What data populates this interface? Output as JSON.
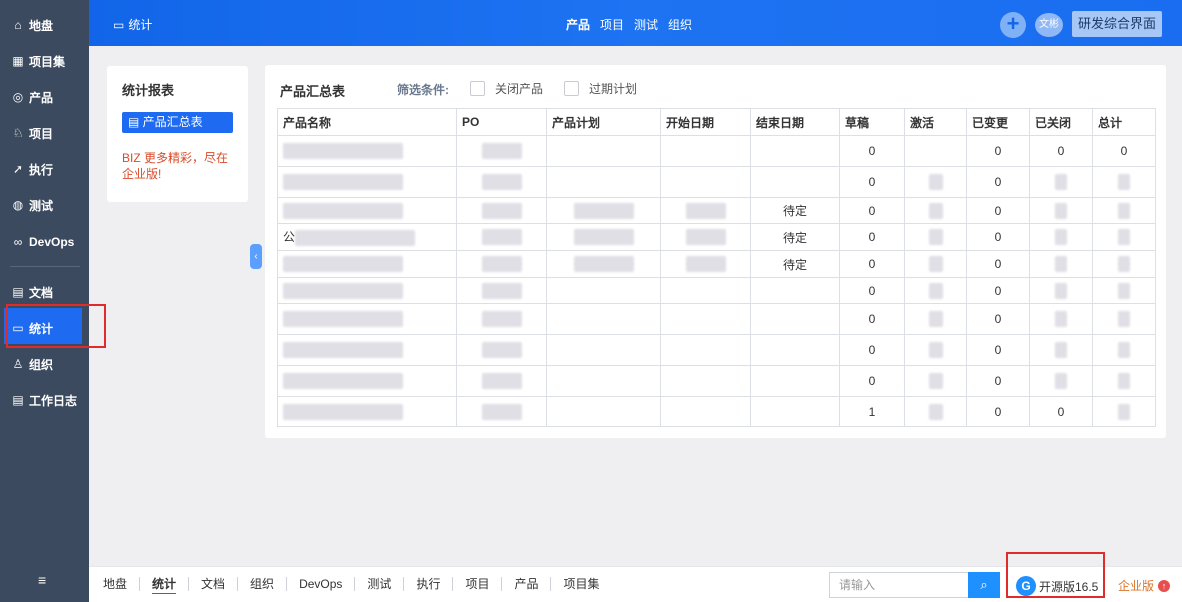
{
  "sidebar": {
    "items": [
      {
        "label": "地盘",
        "icon": "home-icon",
        "glyph": "⌂"
      },
      {
        "label": "项目集",
        "icon": "grid-icon",
        "glyph": "▦"
      },
      {
        "label": "产品",
        "icon": "product-icon",
        "glyph": "◎"
      },
      {
        "label": "项目",
        "icon": "project-icon",
        "glyph": "♘"
      },
      {
        "label": "执行",
        "icon": "run-icon",
        "glyph": "➚"
      },
      {
        "label": "测试",
        "icon": "test-icon",
        "glyph": "◍"
      },
      {
        "label": "DevOps",
        "icon": "infinity-icon",
        "glyph": "∞"
      },
      {
        "label": "文档",
        "icon": "doc-icon",
        "glyph": "▤"
      },
      {
        "label": "统计",
        "icon": "chart-icon",
        "glyph": "▭"
      },
      {
        "label": "组织",
        "icon": "people-icon",
        "glyph": "♙"
      },
      {
        "label": "工作日志",
        "icon": "log-icon",
        "glyph": "▤"
      }
    ],
    "active": "统计",
    "collapse_glyph": "≡"
  },
  "topbar": {
    "title": "统计",
    "title_icon": "chart-icon",
    "nav": [
      "产品",
      "项目",
      "测试",
      "组织"
    ],
    "nav_active": "产品",
    "add_glyph": "+",
    "avatar_text": "文彬",
    "right_button": "研发综合界面"
  },
  "left_panel": {
    "title": "统计报表",
    "link_label": "产品汇总表",
    "biz_tag": "BIZ",
    "biz_text": "更多精彩，尽在企业版!"
  },
  "collapse_glyph": "‹",
  "report": {
    "title": "产品汇总表",
    "filter_label": "筛选条件:",
    "checkbox_closed_product": "关闭产品",
    "checkbox_expired_plan": "过期计划",
    "columns": [
      "产品名称",
      "PO",
      "产品计划",
      "开始日期",
      "结束日期",
      "草稿",
      "激活",
      "已变更",
      "已关闭",
      "总计"
    ],
    "rows": [
      {
        "name": "",
        "end": "",
        "draft": "0",
        "changed": "0",
        "closed": "0",
        "total": "0"
      },
      {
        "name": "",
        "end": "",
        "draft": "0",
        "changed": "0",
        "closed": "",
        "total": ""
      },
      {
        "name": "",
        "end": "待定",
        "draft": "0",
        "changed": "0",
        "closed": "",
        "total": ""
      },
      {
        "name": "公",
        "end": "待定",
        "draft": "0",
        "changed": "0",
        "closed": "",
        "total": ""
      },
      {
        "name": "",
        "end": "待定",
        "draft": "0",
        "changed": "0",
        "closed": "",
        "total": ""
      },
      {
        "name": "",
        "end": "",
        "draft": "0",
        "changed": "0",
        "closed": "",
        "total": ""
      },
      {
        "name": "",
        "end": "",
        "draft": "0",
        "changed": "0",
        "closed": "",
        "total": ""
      },
      {
        "name": "",
        "end": "",
        "draft": "0",
        "changed": "0",
        "closed": "",
        "total": ""
      },
      {
        "name": "",
        "end": "",
        "draft": "0",
        "changed": "0",
        "closed": "",
        "total": ""
      },
      {
        "name": "",
        "end": "",
        "draft": "1",
        "changed": "0",
        "closed": "0",
        "total": ""
      }
    ]
  },
  "bottombar": {
    "nav": [
      "地盘",
      "统计",
      "文档",
      "组织",
      "DevOps",
      "测试",
      "执行",
      "项目",
      "产品",
      "项目集"
    ],
    "nav_active": "统计",
    "search_placeholder": "请输入",
    "search_glyph": "⌕",
    "version": "开源版16.5",
    "enterprise": "企业版",
    "up_glyph": "↑"
  }
}
